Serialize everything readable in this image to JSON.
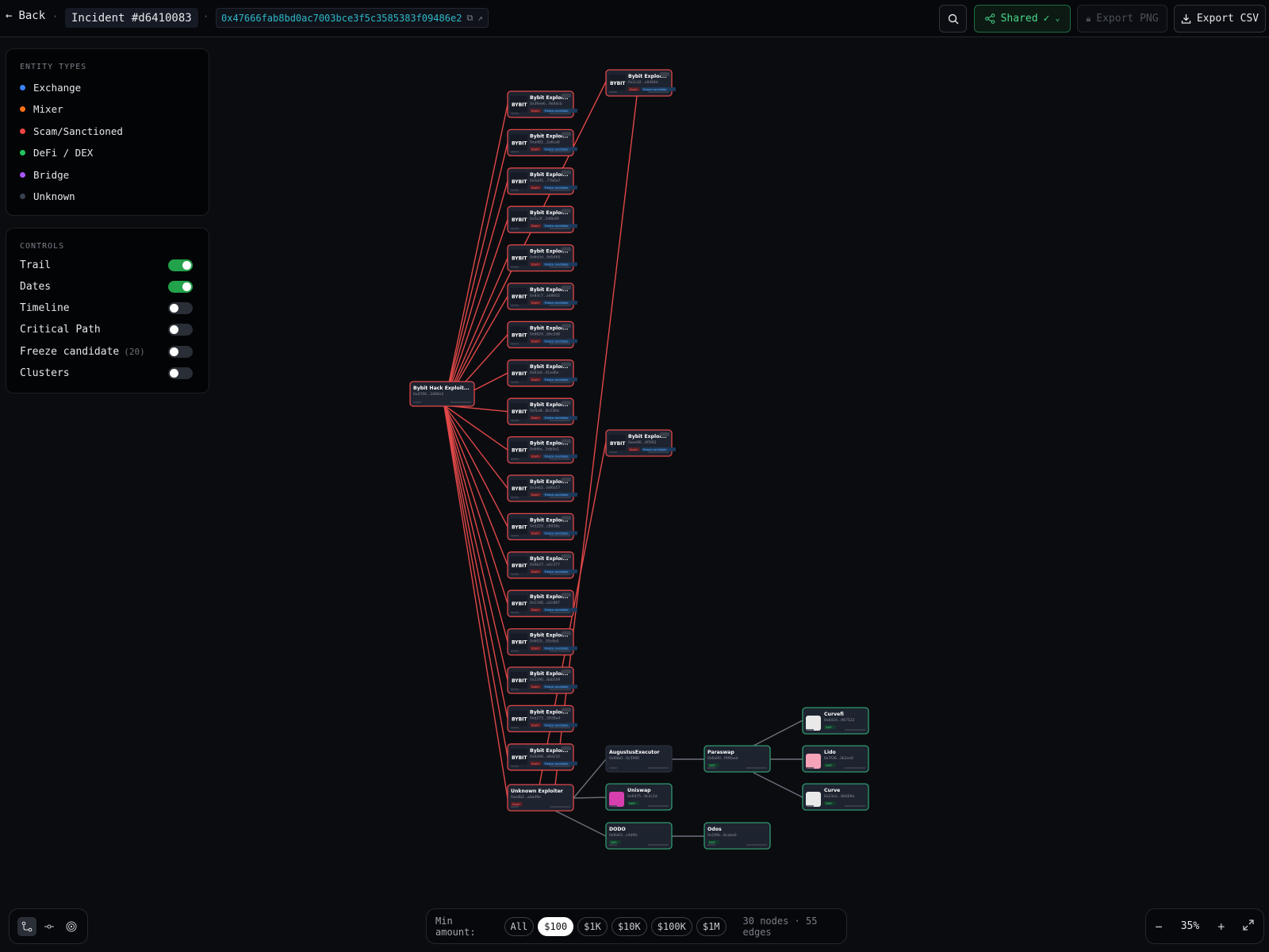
{
  "header": {
    "back_label": "Back",
    "incident_label": "Incident #d6410083",
    "address": "0x47666fab8bd0ac7003bce3f5c3585383f09486e2",
    "shared_label": "Shared",
    "export_png_label": "Export PNG",
    "export_csv_label": "Export CSV"
  },
  "legend": {
    "title": "ENTITY TYPES",
    "items": [
      {
        "label": "Exchange",
        "color": "#3b82f6"
      },
      {
        "label": "Mixer",
        "color": "#f97316"
      },
      {
        "label": "Scam/Sanctioned",
        "color": "#ef4444"
      },
      {
        "label": "DeFi / DEX",
        "color": "#22c55e"
      },
      {
        "label": "Bridge",
        "color": "#a855f7"
      },
      {
        "label": "Unknown",
        "color": "#374151"
      }
    ]
  },
  "controls": {
    "title": "CONTROLS",
    "items": [
      {
        "label": "Trail",
        "on": true
      },
      {
        "label": "Dates",
        "on": true
      },
      {
        "label": "Timeline",
        "on": false
      },
      {
        "label": "Critical Path",
        "on": false
      },
      {
        "label": "Freeze candidate",
        "count": "(20)",
        "on": false
      },
      {
        "label": "Clusters",
        "on": false
      }
    ]
  },
  "filter": {
    "label": "Min amount:",
    "options": [
      "All",
      "$100",
      "$1K",
      "$10K",
      "$100K",
      "$1M"
    ],
    "selected": "$100",
    "stats": "30 nodes · 55 edges"
  },
  "zoom": {
    "level": "35%"
  },
  "graph": {
    "root": {
      "title": "Bybit Hack Exploit...",
      "addr": "0x4766...3486e2"
    },
    "exploiters": [
      {
        "title": "Bybit Exploi...",
        "addr": "0x36ee6...9d4dcb"
      },
      {
        "title": "Bybit Exploi...",
        "addr": "0xad82...2a6ca6"
      },
      {
        "title": "Bybit Exploi...",
        "addr": "0xfa2f1...77b6a7"
      },
      {
        "title": "Bybit Exploi...",
        "addr": "0x5a3f...2d6b49"
      },
      {
        "title": "Bybit Exploi...",
        "addr": "0x6d3d...9d5465"
      },
      {
        "title": "Bybit Exploi...",
        "addr": "0x83c7...a48602"
      },
      {
        "title": "Bybit Exploi...",
        "addr": "0x6624...b6c5d8"
      },
      {
        "title": "Bybit Exploi...",
        "addr": "0x63af...41ad6e"
      },
      {
        "title": "Bybit Exploi...",
        "addr": "0xf1e8...8c236d"
      },
      {
        "title": "Bybit Exploi...",
        "addr": "0x6f6a...5db5e1"
      },
      {
        "title": "Bybit Exploi...",
        "addr": "0x3eb2...b46a57"
      },
      {
        "title": "Bybit Exploi...",
        "addr": "0x5220...c8938e"
      },
      {
        "title": "Bybit Exploi...",
        "addr": "0x6b27...a2c377"
      },
      {
        "title": "Bybit Exploi...",
        "addr": "0x1346...a2c887"
      },
      {
        "title": "Bybit Exploi...",
        "addr": "0x6f25...55c8a5"
      },
      {
        "title": "Bybit Exploi...",
        "addr": "0x2290...8ab509"
      },
      {
        "title": "Bybit Exploi...",
        "addr": "0xb273...5938a4"
      },
      {
        "title": "Bybit Exploi...",
        "addr": "0x6d46...a6dc52"
      }
    ],
    "second_hop": [
      {
        "title": "Bybit Exploi...",
        "addr": "0x2c32...c8484d"
      },
      {
        "title": "Bybit Exploi...",
        "addr": "0xee96...4f5f62"
      }
    ],
    "unknown": {
      "title": "Unknown Exploiter",
      "addr": "0xedb2...ada49e",
      "badge": "Scam"
    },
    "defi": [
      {
        "title": "AugustusExecutor",
        "addr": "0x6bb0...0c5000"
      },
      {
        "title": "Uniswap",
        "addr": "0x6475...9c2c1d",
        "badge": "DeFi"
      },
      {
        "title": "DODO",
        "addr": "0x9a03...c4df6c",
        "badge": "DeFi"
      },
      {
        "title": "Paraswap",
        "addr": "0x6a00...f9f0aed",
        "badge": "DeFi"
      },
      {
        "title": "Odos",
        "addr": "0x1f9b...8cabe0",
        "badge": "DeFi"
      },
      {
        "title": "Curvefi",
        "addr": "0xb024...967522",
        "badge": "DeFi"
      },
      {
        "title": "Lido",
        "addr": "0x7f36...3b2ce0",
        "badge": "DeFi"
      },
      {
        "title": "Curve",
        "addr": "0x23e2...8b669e",
        "badge": "DeFi"
      }
    ],
    "badge_scam": "Scam",
    "badge_freeze": "Freeze candidate",
    "logo_text": "BYBIT"
  }
}
